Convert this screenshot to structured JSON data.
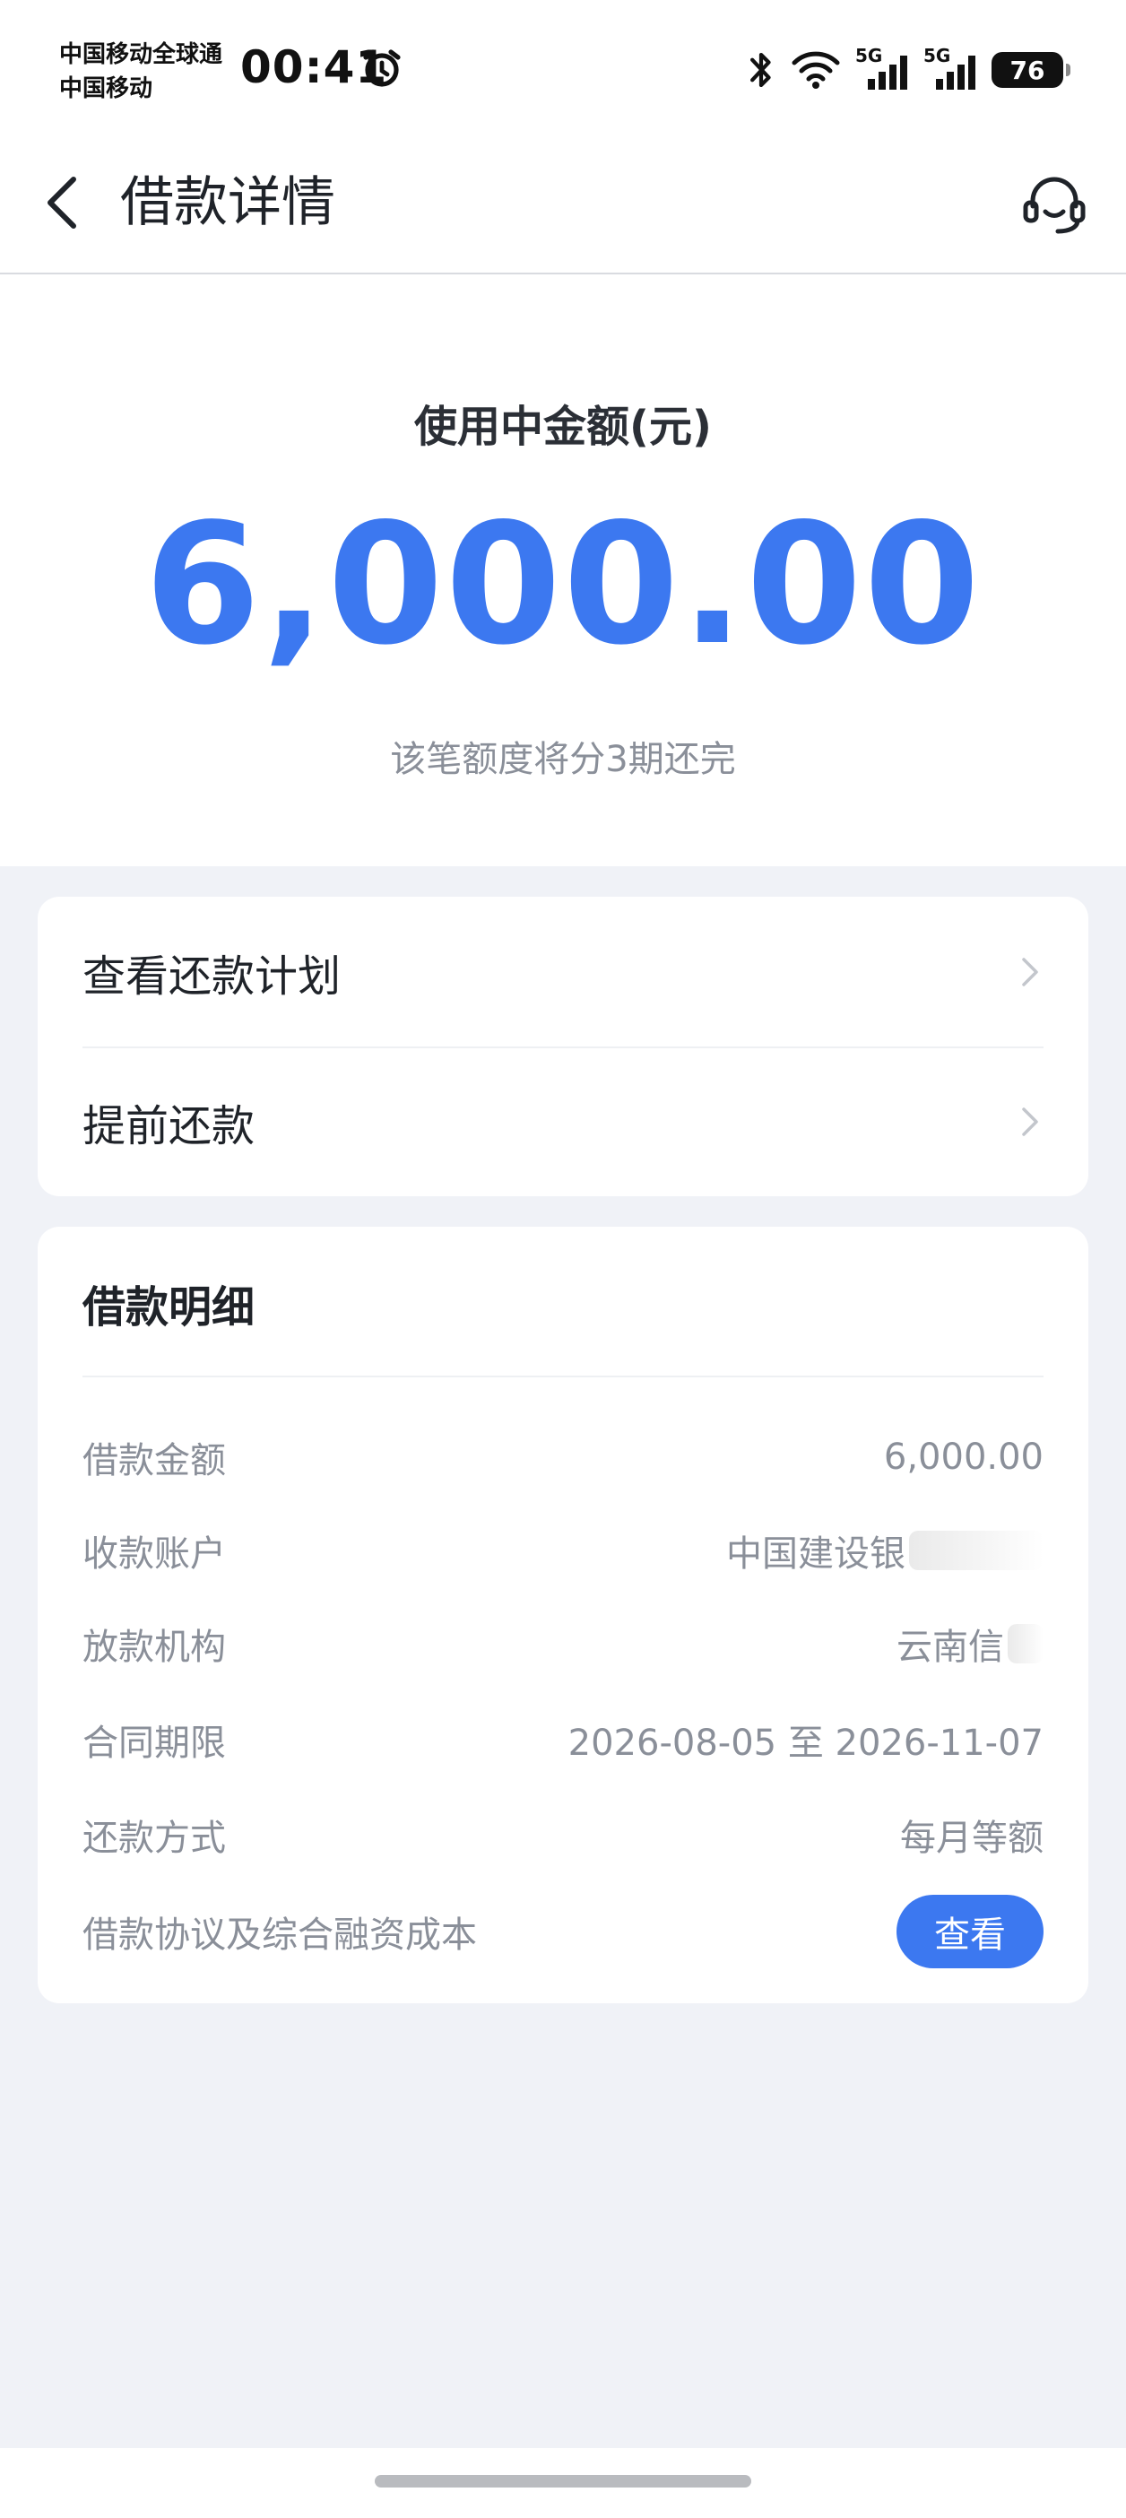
{
  "status_bar": {
    "carrier_line1": "中国移动全球通",
    "carrier_line2": "中国移动",
    "time": "00:41",
    "signal1_tag": "5G",
    "signal2_tag": "5G",
    "battery_level": "76",
    "icons": [
      "alarm-icon",
      "bluetooth-icon",
      "wifi-icon",
      "signal-icon",
      "battery-icon"
    ]
  },
  "nav": {
    "title": "借款详情",
    "back_icon": "chevron-left-icon",
    "support_icon": "customer-service-icon"
  },
  "hero": {
    "label": "使用中金额(元)",
    "amount": "6,000.00",
    "subtitle": "该笔额度将分3期还完"
  },
  "actions": [
    {
      "label": "查看还款计划"
    },
    {
      "label": "提前还款"
    }
  ],
  "details": {
    "title": "借款明细",
    "rows": [
      {
        "label": "借款金额",
        "value": "6,000.00"
      },
      {
        "label": "收款账户",
        "value": "中国建设银"
      },
      {
        "label": "放款机构",
        "value": "云南信"
      },
      {
        "label": "合同期限",
        "value": "2026-08-05 至 2026-11-07"
      },
      {
        "label": "还款方式",
        "value": "每月等额"
      },
      {
        "label": "借款协议及综合融资成本",
        "button": "查看"
      }
    ]
  },
  "colors": {
    "accent": "#3c78f0",
    "background": "#f0f2f7",
    "muted_text": "#8a8f99"
  }
}
